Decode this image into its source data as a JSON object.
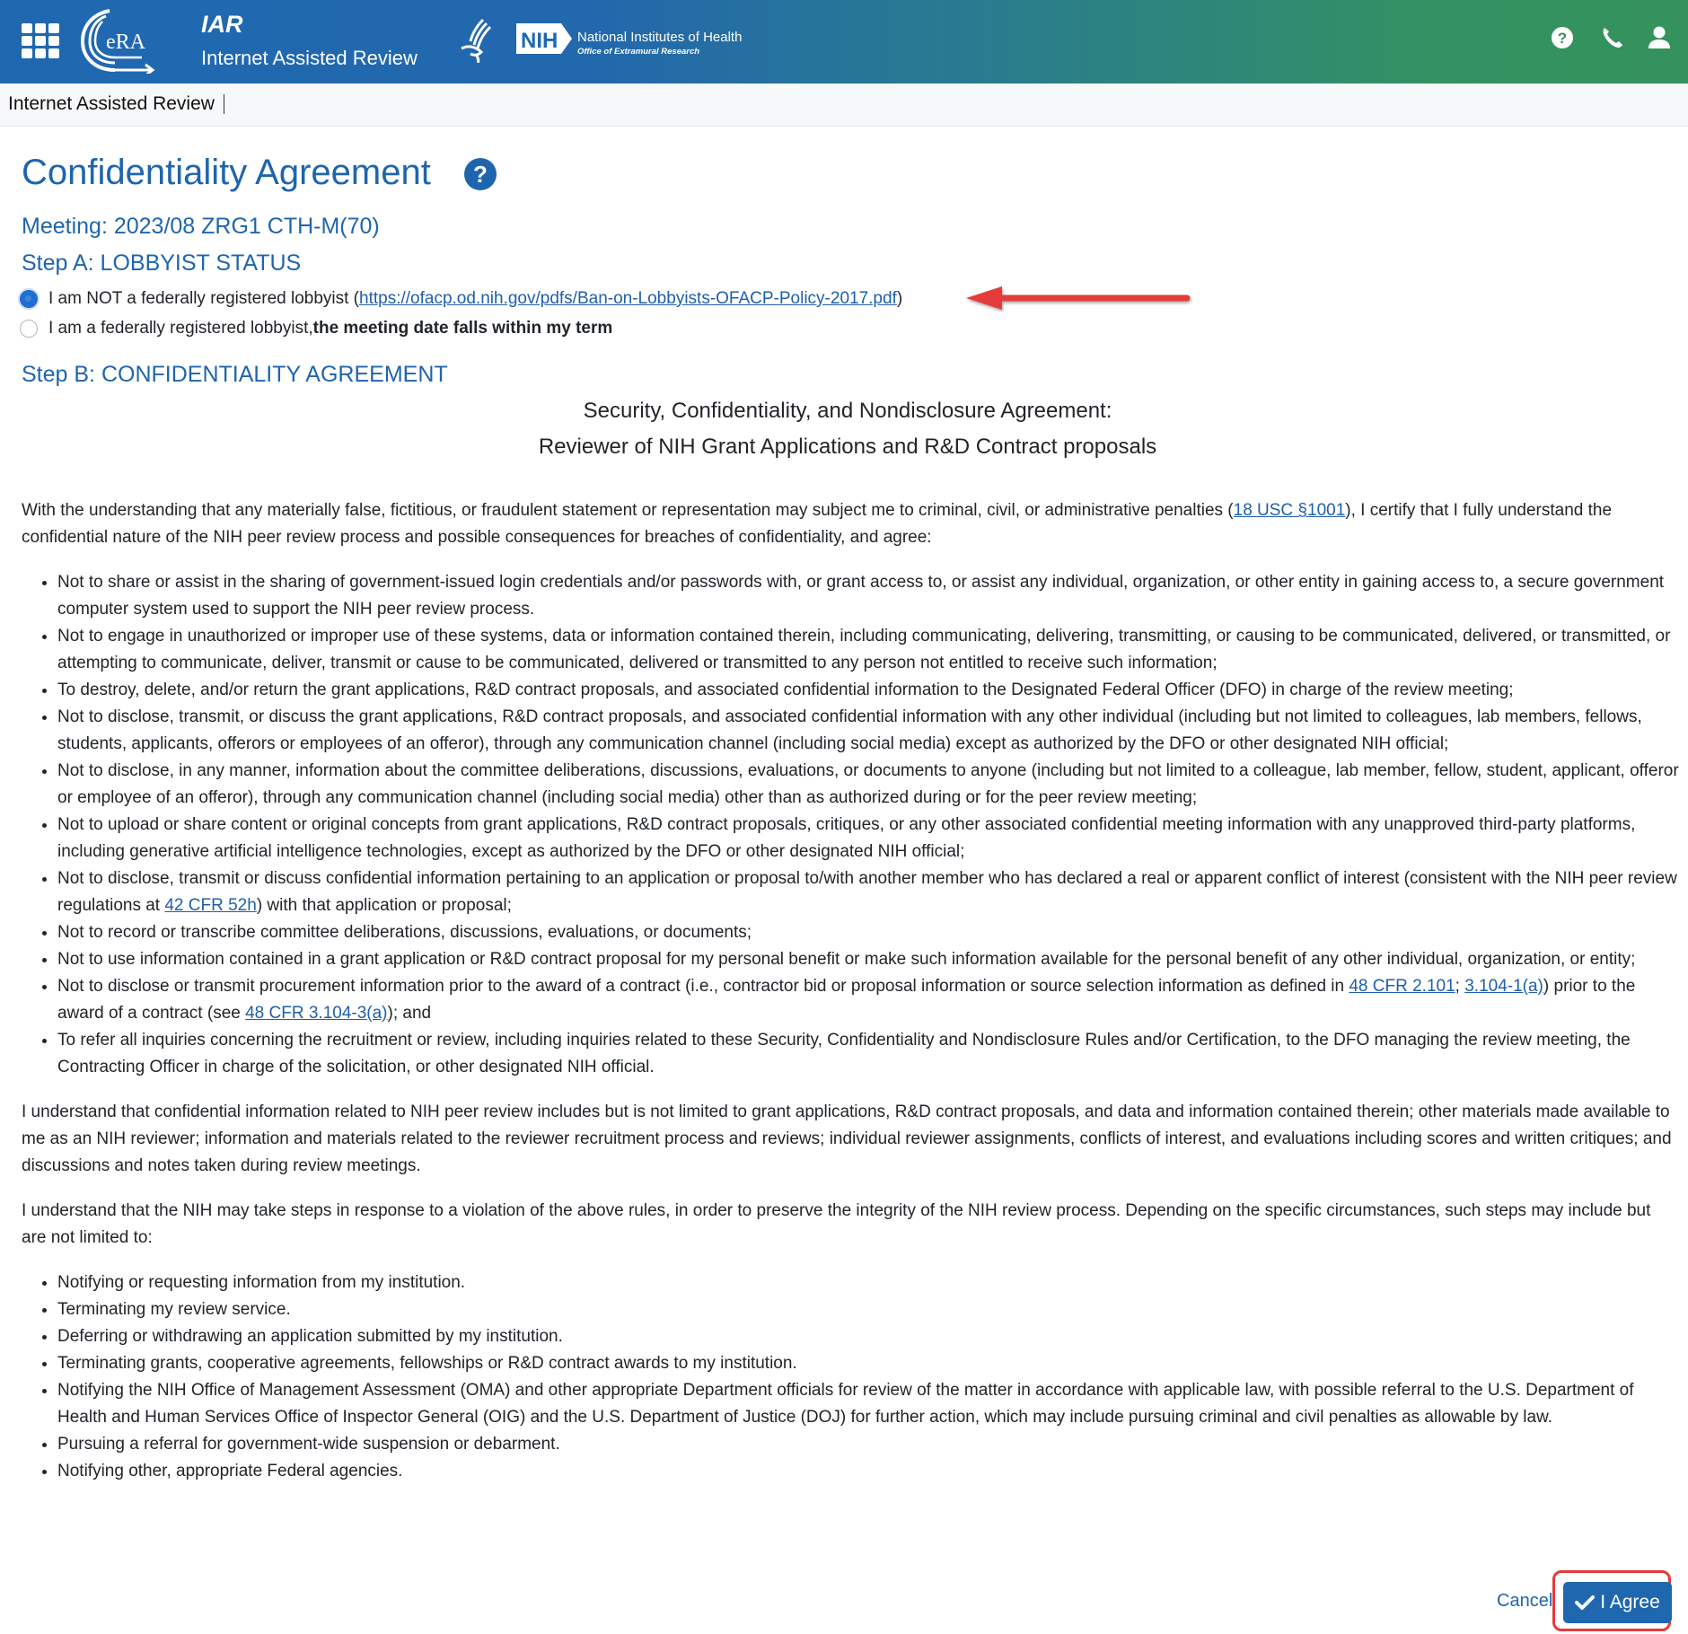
{
  "header": {
    "app_short": "IAR",
    "app_name": "Internet Assisted Review",
    "nih_name": "National Institutes of Health",
    "nih_office": "Office of Extramural Research",
    "nih_abbrev": "NIH",
    "era_text": "eRA",
    "icons": [
      "apps-grid-icon",
      "era-logo",
      "hhs-logo",
      "nih-logo",
      "help-icon",
      "phone-icon",
      "user-icon"
    ]
  },
  "subnav": {
    "title": "Internet Assisted Review"
  },
  "page": {
    "title": "Confidentiality Agreement",
    "meeting": "Meeting: 2023/08 ZRG1 CTH-M(70)",
    "stepA_title": "Step A: LOBBYIST STATUS",
    "radio_not_lobbyist": {
      "prefix": "I am NOT a federally registered lobbyist (",
      "link": "https://ofacp.od.nih.gov/pdfs/Ban-on-Lobbyists-OFACP-Policy-2017.pdf",
      "suffix": ")",
      "checked": true
    },
    "radio_lobbyist": {
      "prefix": "I am a federally registered lobbyist, ",
      "bold": "the meeting date falls within my term",
      "checked": false
    },
    "stepB_title": "Step B: CONFIDENTIALITY AGREEMENT",
    "agreement_heading_1": "Security, Confidentiality, and Nondisclosure Agreement:",
    "agreement_heading_2": "Reviewer of NIH Grant Applications and R&D Contract proposals"
  },
  "agreement": {
    "intro": {
      "before": "With the understanding that any materially false, fictitious, or fraudulent statement or representation may subject me to criminal, civil, or administrative penalties (",
      "link": "18 USC §1001",
      "after": "), I certify that I fully understand the confidential nature of the NIH peer review process and possible consequences for breaches of confidentiality, and agree:"
    },
    "agree_items": [
      {
        "text": "Not to share or assist in the sharing of government-issued login credentials and/or passwords with, or grant access to, or assist any individual, organization, or other entity in gaining access to, a secure government computer system used to support the NIH peer review process."
      },
      {
        "text": "Not to engage in unauthorized or improper use of these systems, data or information contained therein, including communicating, delivering, transmitting, or causing to be communicated, delivered, or transmitted, or attempting to communicate, deliver, transmit or cause to be communicated, delivered or transmitted to any person not entitled to receive such information;"
      },
      {
        "text": "To destroy, delete, and/or return the grant applications, R&D contract proposals, and associated confidential information to the Designated Federal Officer (DFO) in charge of the review meeting;"
      },
      {
        "text": "Not to disclose, transmit, or discuss the grant applications, R&D contract proposals, and associated confidential information with any other individual (including but not limited to colleagues, lab members, fellows, students, applicants, offerors or employees of an offeror), through any communication channel (including social media) except as authorized by the DFO or other designated NIH official;"
      },
      {
        "text": "Not to disclose, in any manner, information about the committee deliberations, discussions, evaluations, or documents to anyone (including but not limited to a colleague, lab member, fellow, student, applicant, offeror or employee of an offeror), through any communication channel (including social media) other than as authorized during or for the peer review meeting;"
      },
      {
        "text": "Not to upload or share content or original concepts from grant applications, R&D contract proposals, critiques, or any other associated confidential meeting information with any unapproved third-party platforms, including generative artificial intelligence technologies, except as authorized by the DFO or other designated NIH official;"
      },
      {
        "text": "Not to disclose, transmit or discuss confidential information pertaining to an application or proposal to/with another member who has declared a real or apparent conflict of interest (consistent with the NIH peer review regulations at ",
        "link1": "42 CFR 52h",
        "text2": ") with that application or proposal;"
      },
      {
        "text": "Not to record or transcribe committee deliberations, discussions, evaluations, or documents;"
      },
      {
        "text": "Not to use information contained in a grant application or R&D contract proposal for my personal benefit or make such information available for the personal benefit of any other individual, organization, or entity;"
      },
      {
        "text": "Not to disclose or transmit procurement information prior to the award of a contract (i.e., contractor bid or proposal information or source selection information as defined in ",
        "link1": "48 CFR 2.101",
        "text2": "; ",
        "link2": "3.104-1(a)",
        "text3": ") prior to the award of a contract (see ",
        "link3": "48 CFR 3.104-3(a)",
        "text4": "); and"
      },
      {
        "text": "To refer all inquiries concerning the recruitment or review, including inquiries related to these Security, Confidentiality and Nondisclosure Rules and/or Certification, to the DFO managing the review meeting, the Contracting Officer in charge of the solicitation, or other designated NIH official."
      }
    ],
    "understand_1": "I understand that confidential information related to NIH peer review includes but is not limited to grant applications, R&D contract proposals, and data and information contained therein; other materials made available to me as an NIH reviewer; information and materials related to the reviewer recruitment process and reviews; individual reviewer assignments, conflicts of interest, and evaluations including scores and written critiques; and discussions and notes taken during review meetings.",
    "understand_2": "I understand that the NIH may take steps in response to a violation of the above rules, in order to preserve the integrity of the NIH review process. Depending on the specific circumstances, such steps may include but are not limited to:",
    "steps": [
      "Notifying or requesting information from my institution.",
      "Terminating my review service.",
      "Deferring or withdrawing an application submitted by my institution.",
      "Terminating grants, cooperative agreements, fellowships or R&D contract awards to my institution.",
      "Notifying the NIH Office of Management Assessment (OMA) and other appropriate Department officials for review of the matter in accordance with applicable law, with possible referral to the U.S. Department of Health and Human Services Office of Inspector General (OIG) and the U.S. Department of Justice (DOJ) for further action, which may include pursuing criminal and civil penalties as allowable by law.",
      "Pursuing a referral for government-wide suspension or debarment.",
      "Notifying other, appropriate Federal agencies."
    ]
  },
  "footer": {
    "cancel_label": "Cancel",
    "agree_label": "I Agree"
  },
  "colors": {
    "brand_blue": "#1f65ad",
    "header_gradient_start": "#1f68b0",
    "header_gradient_end": "#35925d",
    "annotation_red": "#e63a3a",
    "link": "#1f5fa8"
  }
}
